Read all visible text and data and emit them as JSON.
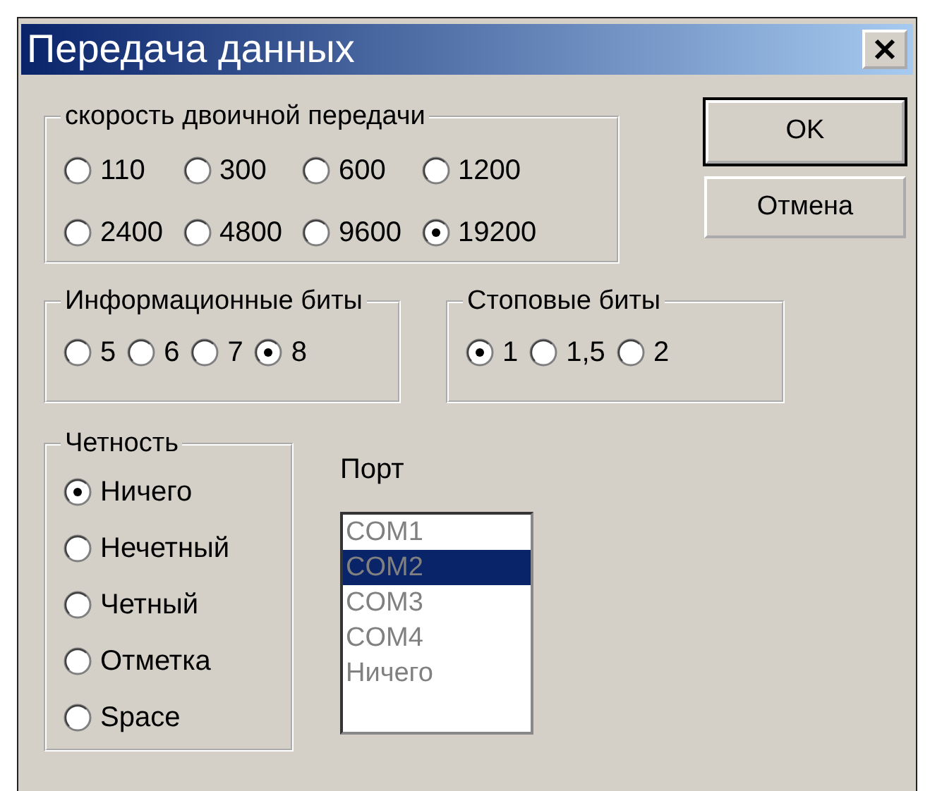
{
  "window": {
    "title": "Передача данных"
  },
  "baud_rate": {
    "label": "скорость двоичной передачи",
    "options": [
      {
        "label": "110",
        "selected": false
      },
      {
        "label": "300",
        "selected": false
      },
      {
        "label": "600",
        "selected": false
      },
      {
        "label": "1200",
        "selected": false
      },
      {
        "label": "2400",
        "selected": false
      },
      {
        "label": "4800",
        "selected": false
      },
      {
        "label": "9600",
        "selected": false
      },
      {
        "label": "19200",
        "selected": true
      }
    ]
  },
  "buttons": [
    {
      "label": "OK",
      "default": true
    },
    {
      "label": "Отмена",
      "default": false
    }
  ],
  "data_bits": {
    "label": "Информационные биты",
    "options": [
      {
        "label": "5",
        "selected": false
      },
      {
        "label": "6",
        "selected": false
      },
      {
        "label": "7",
        "selected": false
      },
      {
        "label": "8",
        "selected": true
      }
    ]
  },
  "stop_bits": {
    "label": "Стоповые биты",
    "options": [
      {
        "label": "1",
        "selected": true
      },
      {
        "label": "1,5",
        "selected": false
      },
      {
        "label": "2",
        "selected": false
      }
    ]
  },
  "parity": {
    "label": "Четность",
    "options": [
      {
        "label": "Ничего",
        "selected": true
      },
      {
        "label": "Нечетный",
        "selected": false
      },
      {
        "label": "Четный",
        "selected": false
      },
      {
        "label": "Отметка",
        "selected": false
      },
      {
        "label": "Space",
        "selected": false
      }
    ]
  },
  "port": {
    "label": "Порт",
    "items": [
      {
        "label": "COM1",
        "selected": false
      },
      {
        "label": "COM2",
        "selected": true
      },
      {
        "label": "COM3",
        "selected": false
      },
      {
        "label": "COM4",
        "selected": false
      },
      {
        "label": "Ничего",
        "selected": false
      }
    ]
  }
}
